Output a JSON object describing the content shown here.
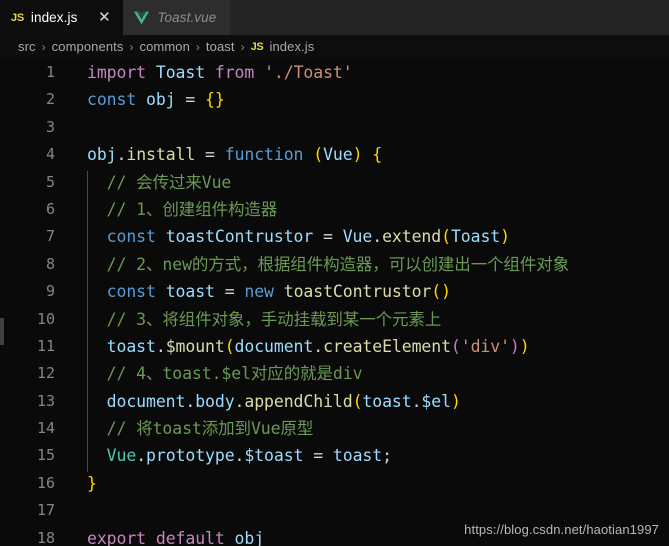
{
  "window": {
    "app": "Visual Studio Code",
    "watermark": "https://blog.csdn.net/haotian1997"
  },
  "tabs": [
    {
      "icon": "js-file-icon",
      "icon_label": "JS",
      "label": "index.js",
      "active": true,
      "close_glyph": "✕"
    },
    {
      "icon": "vue-file-icon",
      "icon_label": "V",
      "label": "Toast.vue",
      "active": false
    }
  ],
  "breadcrumb": {
    "separator": "›",
    "items": [
      "src",
      "components",
      "common",
      "toast"
    ],
    "file_icon_label": "JS",
    "file": "index.js"
  },
  "editor": {
    "language": "javascript",
    "line_numbers": [
      "1",
      "2",
      "3",
      "4",
      "5",
      "6",
      "7",
      "8",
      "9",
      "10",
      "11",
      "12",
      "13",
      "14",
      "15",
      "16",
      "17",
      "18"
    ],
    "lines": [
      {
        "n": "1",
        "tokens": [
          {
            "t": "import",
            "c": "t-kw"
          },
          {
            "t": " ",
            "c": "t-punct"
          },
          {
            "t": "Toast",
            "c": "t-var"
          },
          {
            "t": " ",
            "c": "t-punct"
          },
          {
            "t": "from",
            "c": "t-kw"
          },
          {
            "t": " ",
            "c": "t-punct"
          },
          {
            "t": "'./Toast'",
            "c": "t-str"
          }
        ]
      },
      {
        "n": "2",
        "tokens": [
          {
            "t": "const",
            "c": "t-ctl"
          },
          {
            "t": " ",
            "c": "t-punct"
          },
          {
            "t": "obj",
            "c": "t-var"
          },
          {
            "t": " = ",
            "c": "t-punct"
          },
          {
            "t": "{}",
            "c": "t-brace1"
          }
        ]
      },
      {
        "n": "3",
        "tokens": []
      },
      {
        "n": "4",
        "tokens": [
          {
            "t": "obj",
            "c": "t-var"
          },
          {
            "t": ".",
            "c": "t-punct"
          },
          {
            "t": "install",
            "c": "t-fn"
          },
          {
            "t": " = ",
            "c": "t-punct"
          },
          {
            "t": "function",
            "c": "t-ctl"
          },
          {
            "t": " ",
            "c": "t-punct"
          },
          {
            "t": "(",
            "c": "t-brace1"
          },
          {
            "t": "Vue",
            "c": "t-var"
          },
          {
            "t": ")",
            "c": "t-brace1"
          },
          {
            "t": " ",
            "c": "t-punct"
          },
          {
            "t": "{",
            "c": "t-brace1"
          }
        ]
      },
      {
        "n": "5",
        "tokens": [
          {
            "t": "  // 会传过来Vue",
            "c": "t-cmt"
          }
        ]
      },
      {
        "n": "6",
        "tokens": [
          {
            "t": "  // 1、创建组件构造器",
            "c": "t-cmt"
          }
        ]
      },
      {
        "n": "7",
        "tokens": [
          {
            "t": "  ",
            "c": "t-punct"
          },
          {
            "t": "const",
            "c": "t-ctl"
          },
          {
            "t": " ",
            "c": "t-punct"
          },
          {
            "t": "toastContrustor",
            "c": "t-var"
          },
          {
            "t": " = ",
            "c": "t-punct"
          },
          {
            "t": "Vue",
            "c": "t-var"
          },
          {
            "t": ".",
            "c": "t-punct"
          },
          {
            "t": "extend",
            "c": "t-fn"
          },
          {
            "t": "(",
            "c": "t-brace1"
          },
          {
            "t": "Toast",
            "c": "t-var"
          },
          {
            "t": ")",
            "c": "t-brace1"
          }
        ]
      },
      {
        "n": "8",
        "tokens": [
          {
            "t": "  // 2、new的方式，根据组件构造器，可以创建出一个组件对象",
            "c": "t-cmt"
          }
        ]
      },
      {
        "n": "9",
        "tokens": [
          {
            "t": "  ",
            "c": "t-punct"
          },
          {
            "t": "const",
            "c": "t-ctl"
          },
          {
            "t": " ",
            "c": "t-punct"
          },
          {
            "t": "toast",
            "c": "t-var"
          },
          {
            "t": " = ",
            "c": "t-punct"
          },
          {
            "t": "new",
            "c": "t-ctl"
          },
          {
            "t": " ",
            "c": "t-punct"
          },
          {
            "t": "toastContrustor",
            "c": "t-fn"
          },
          {
            "t": "()",
            "c": "t-brace1"
          }
        ]
      },
      {
        "n": "10",
        "tokens": [
          {
            "t": "  // 3、将组件对象，手动挂载到某一个元素上",
            "c": "t-cmt"
          }
        ]
      },
      {
        "n": "11",
        "tokens": [
          {
            "t": "  ",
            "c": "t-punct"
          },
          {
            "t": "toast",
            "c": "t-var"
          },
          {
            "t": ".",
            "c": "t-punct"
          },
          {
            "t": "$mount",
            "c": "t-fn"
          },
          {
            "t": "(",
            "c": "t-brace1"
          },
          {
            "t": "document",
            "c": "t-var"
          },
          {
            "t": ".",
            "c": "t-punct"
          },
          {
            "t": "createElement",
            "c": "t-fn"
          },
          {
            "t": "(",
            "c": "t-brace2"
          },
          {
            "t": "'div'",
            "c": "t-str"
          },
          {
            "t": ")",
            "c": "t-brace2"
          },
          {
            "t": ")",
            "c": "t-brace1"
          }
        ]
      },
      {
        "n": "12",
        "tokens": [
          {
            "t": "  // 4、toast.$el对应的就是div",
            "c": "t-cmt"
          }
        ]
      },
      {
        "n": "13",
        "tokens": [
          {
            "t": "  ",
            "c": "t-punct"
          },
          {
            "t": "document",
            "c": "t-var"
          },
          {
            "t": ".",
            "c": "t-punct"
          },
          {
            "t": "body",
            "c": "t-var"
          },
          {
            "t": ".",
            "c": "t-punct"
          },
          {
            "t": "appendChild",
            "c": "t-fn"
          },
          {
            "t": "(",
            "c": "t-brace1"
          },
          {
            "t": "toast",
            "c": "t-var"
          },
          {
            "t": ".",
            "c": "t-punct"
          },
          {
            "t": "$el",
            "c": "t-var"
          },
          {
            "t": ")",
            "c": "t-brace1"
          }
        ]
      },
      {
        "n": "14",
        "tokens": [
          {
            "t": "  // 将toast添加到Vue原型",
            "c": "t-cmt"
          }
        ]
      },
      {
        "n": "15",
        "tokens": [
          {
            "t": "  ",
            "c": "t-punct"
          },
          {
            "t": "Vue",
            "c": "t-cls"
          },
          {
            "t": ".",
            "c": "t-punct"
          },
          {
            "t": "prototype",
            "c": "t-var"
          },
          {
            "t": ".",
            "c": "t-punct"
          },
          {
            "t": "$toast",
            "c": "t-var"
          },
          {
            "t": " = ",
            "c": "t-punct"
          },
          {
            "t": "toast",
            "c": "t-var"
          },
          {
            "t": ";",
            "c": "t-punct"
          }
        ]
      },
      {
        "n": "16",
        "tokens": [
          {
            "t": "}",
            "c": "t-brace1"
          }
        ]
      },
      {
        "n": "17",
        "tokens": []
      },
      {
        "n": "18",
        "tokens": [
          {
            "t": "export",
            "c": "t-kw"
          },
          {
            "t": " ",
            "c": "t-punct"
          },
          {
            "t": "default",
            "c": "t-kw"
          },
          {
            "t": " ",
            "c": "t-punct"
          },
          {
            "t": "obj",
            "c": "t-var"
          }
        ]
      }
    ]
  },
  "colors": {
    "editor_bg": "#0a0a0a",
    "tabbar_bg": "#252526",
    "tab_active_bg": "#0d0d0d",
    "tab_inactive_bg": "#2d2d2d",
    "line_number": "#858585",
    "keyword": "#c586c0",
    "control": "#569cd6",
    "variable": "#9cdcfe",
    "string": "#ce9178",
    "function": "#dcdcaa",
    "class": "#4ec9b0",
    "comment": "#6a9955",
    "bracket1": "#ffd700",
    "bracket2": "#da70d6",
    "js_icon": "#e8d44d",
    "vue_icon": "#41b883"
  }
}
